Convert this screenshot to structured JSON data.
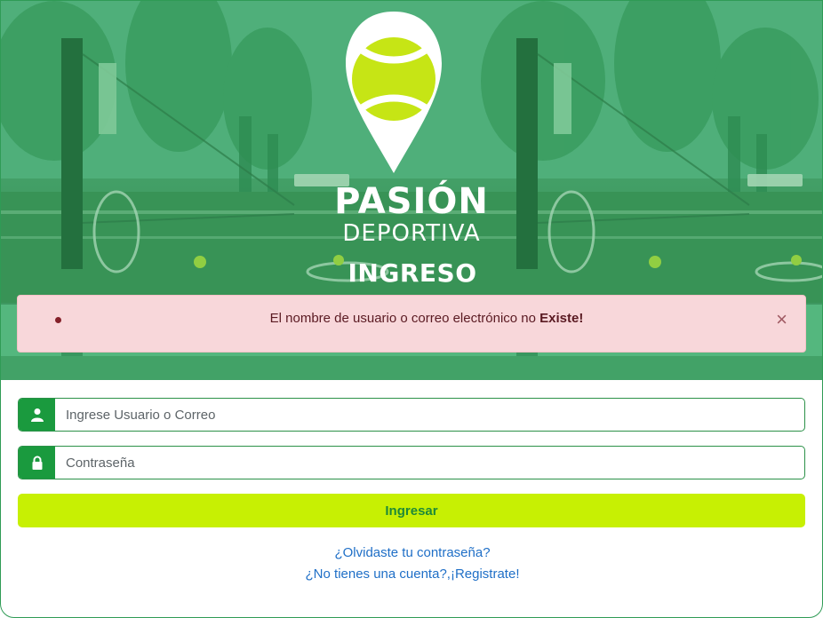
{
  "brand": {
    "name_line1": "PASIÓN",
    "name_line2": "DEPORTIVA",
    "colors": {
      "primary_green": "#1a9a3e",
      "accent_lime": "#c7f003",
      "ball": "#c6e515"
    }
  },
  "page": {
    "title": "INGRESO"
  },
  "alert": {
    "message": "El nombre de usuario o correo electrónico no ",
    "emphasis": "Existe!",
    "close_label": "×",
    "colors": {
      "bg": "#f8d7da",
      "text": "#842029"
    }
  },
  "form": {
    "username": {
      "icon": "user-icon",
      "placeholder": "Ingrese Usuario o Correo",
      "value": ""
    },
    "password": {
      "icon": "lock-icon",
      "placeholder": "Contraseña",
      "value": ""
    },
    "submit_label": "Ingresar"
  },
  "links": {
    "forgot": "¿Olvidaste tu contraseña?",
    "register": "¿No tienes una cuenta?,¡Registrate!"
  }
}
